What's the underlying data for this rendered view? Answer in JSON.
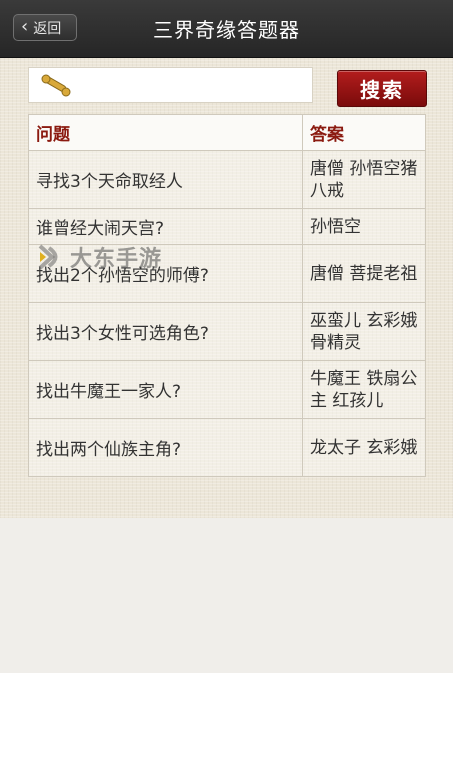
{
  "header": {
    "back_label": "返回",
    "title": "三界奇缘答题器"
  },
  "search": {
    "value": "",
    "button_label": "搜索"
  },
  "table": {
    "headers": {
      "question": "问题",
      "answer": "答案"
    },
    "rows": [
      {
        "question": "寻找3个天命取经人",
        "answer": "唐僧 孙悟空猪八戒"
      },
      {
        "question": "谁曾经大闹天宫?",
        "answer": "孙悟空"
      },
      {
        "question": "找出2个孙悟空的师傅?",
        "answer": "唐僧 菩提老祖"
      },
      {
        "question": "找出3个女性可选角色?",
        "answer": "巫蛮儿 玄彩娥 骨精灵"
      },
      {
        "question": "找出牛魔王一家人?",
        "answer": "牛魔王 铁扇公主 红孩儿"
      },
      {
        "question": "找出两个仙族主角?",
        "answer": "龙太子 玄彩娥"
      }
    ]
  },
  "watermark": {
    "text": "大东手游"
  },
  "colors": {
    "topbar": "#2e2e2e",
    "search_button": "#9a1414",
    "header_text": "#8b1a10"
  }
}
